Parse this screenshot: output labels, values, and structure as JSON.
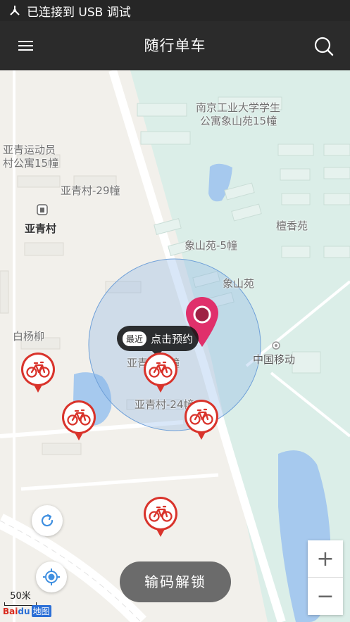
{
  "status_bar": {
    "text": "已连接到 USB 调试",
    "icon": "usb-icon"
  },
  "app_bar": {
    "title": "随行单车",
    "menu_icon": "menu-icon",
    "search_icon": "search-icon"
  },
  "map": {
    "labels": {
      "nanjing_campus": "南京工业大学学生",
      "nanjing_campus2": "公寓象山苑15幢",
      "yaqing_staff": "亚青运动员",
      "yaqing_staff2": "村公寓15幢",
      "yaqing_29": "亚青村-29幢",
      "yaqing": "亚青村",
      "tanxiang": "檀香苑",
      "xiangshan_5": "象山苑-5幢",
      "xiangshan": "象山苑",
      "baiyangliu": "白杨柳",
      "china_mobile": "中国移动",
      "yaqing_5": "亚青村-5幢",
      "yaqing_24": "亚青村-24幢"
    },
    "tooltip": {
      "tag": "最近",
      "text": "点击预约"
    },
    "bike_icon": "bicycle-icon",
    "location_pin_color": "#e0306b",
    "bike_color": "#d9332b"
  },
  "controls": {
    "unlock_label": "输码解锁",
    "zoom_in": "+",
    "zoom_out": "−",
    "refresh_icon": "refresh-icon",
    "locate_icon": "locate-icon",
    "scale_label": "50米",
    "logo_text": "Bai",
    "logo_du": "du",
    "logo_map": "地图"
  }
}
